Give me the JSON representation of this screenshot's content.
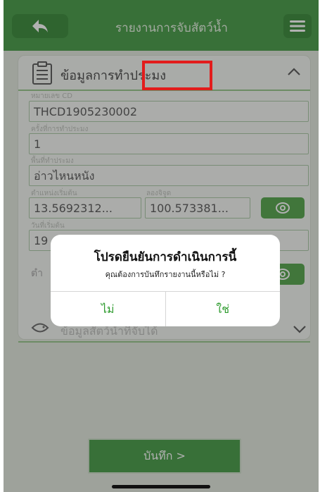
{
  "header": {
    "title": "รายงานการจับสัตว์น้ำ",
    "back_icon": "back-arrow-icon",
    "menu_icon": "hamburger-menu-icon"
  },
  "card": {
    "title": "ข้อมูลการทำประมง",
    "fields": {
      "cd_label": "หมายเลข CD",
      "cd_value": "THCD1905230002",
      "trip_label": "ครั้งที่การทำประมง",
      "trip_value": "1",
      "area_label": "พื้นที่ทำประมง",
      "area_value": "อ่าวไหนหนัง",
      "start_pos_label": "ตำแหน่งเริ่มต้น",
      "lon_label": "ลองจิจูด",
      "lat_value": "13.5692312...",
      "lon_value": "100.573381...",
      "start_date_label": "วันที่เริ่มต้น",
      "start_date_value": "19"
    },
    "section2_title": "ข้อมูลสัตว์น้ำที่จับได้"
  },
  "save_button": {
    "label": "บันทึก >"
  },
  "dialog": {
    "title": "โปรดยืนยันการดำเนินการนี้",
    "message": "คุณต้องการบันทึกรายงานนี้หรือไม่ ?",
    "no_label": "ไม่",
    "yes_label": "ใช่"
  },
  "colors": {
    "header": "#2f8f2f",
    "accent": "#2e9b2e",
    "highlight": "#e21c1c"
  }
}
